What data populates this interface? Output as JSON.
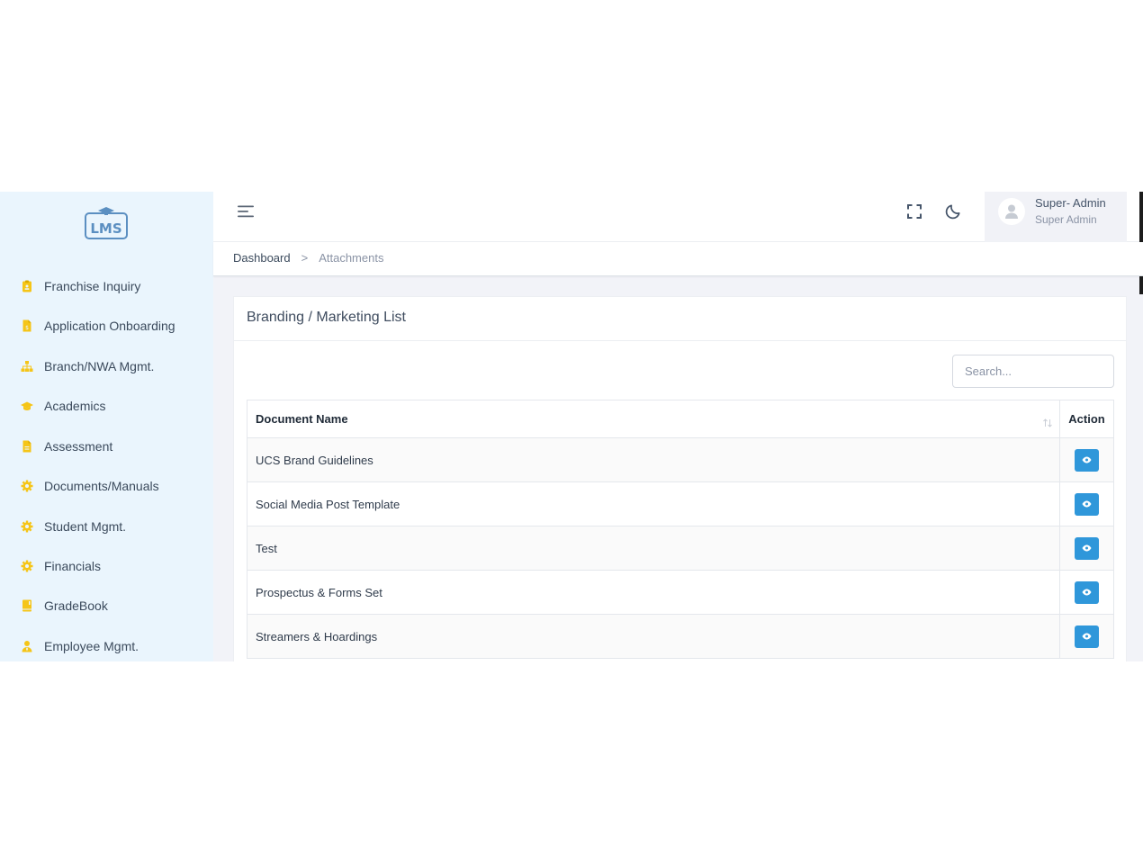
{
  "sidebar": {
    "logo_text": "LMS",
    "items": [
      {
        "label": "Franchise Inquiry",
        "icon": "clipboard-user-icon"
      },
      {
        "label": "Application Onboarding",
        "icon": "file-invoice-icon"
      },
      {
        "label": "Branch/NWA Mgmt.",
        "icon": "sitemap-icon"
      },
      {
        "label": "Academics",
        "icon": "graduation-cap-icon"
      },
      {
        "label": "Assessment",
        "icon": "file-text-icon"
      },
      {
        "label": "Documents/Manuals",
        "icon": "gear-icon"
      },
      {
        "label": "Student Mgmt.",
        "icon": "gear-icon"
      },
      {
        "label": "Financials",
        "icon": "gear-icon"
      },
      {
        "label": "GradeBook",
        "icon": "book-icon"
      },
      {
        "label": "Employee Mgmt.",
        "icon": "user-tie-icon"
      }
    ]
  },
  "header": {
    "user_name": "Super- Admin",
    "user_role": "Super Admin"
  },
  "breadcrumb": {
    "home": "Dashboard",
    "separator": ">",
    "current": "Attachments"
  },
  "card": {
    "title": "Branding / Marketing List",
    "search_placeholder": "Search..."
  },
  "table": {
    "columns": [
      "Document Name",
      "Action"
    ],
    "rows": [
      {
        "name": "UCS Brand Guidelines"
      },
      {
        "name": "Social Media Post Template"
      },
      {
        "name": "Test"
      },
      {
        "name": "Prospectus & Forms Set"
      },
      {
        "name": "Streamers & Hoardings"
      }
    ]
  },
  "colors": {
    "sidebar_bg": "#eaf5fd",
    "icon_yellow": "#f5c518",
    "action_blue": "#2f97da",
    "page_bg": "#f2f3f8"
  }
}
